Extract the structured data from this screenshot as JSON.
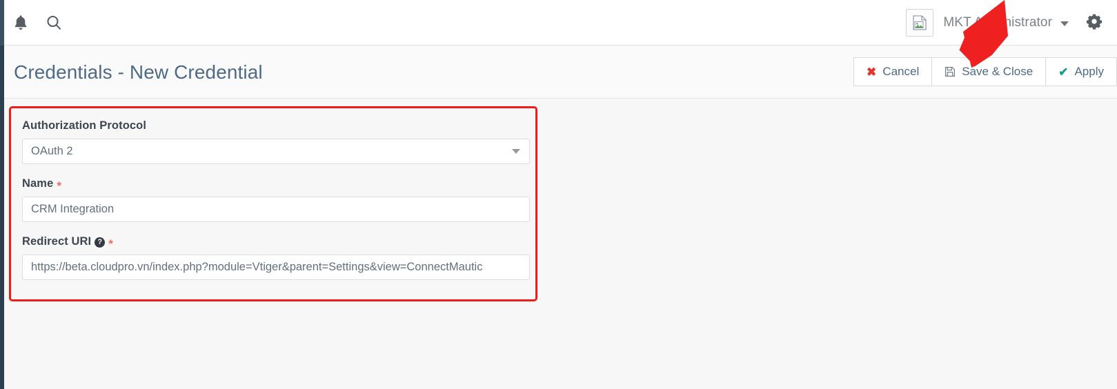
{
  "topbar": {
    "notifications_icon": "bell-icon",
    "search_icon": "search-icon",
    "avatar_alt": "broken-image-icon",
    "user_name": "MKT Administrator",
    "user_caret_icon": "chevron-down-icon",
    "settings_icon": "gear-icon"
  },
  "header": {
    "title": "Credentials - New Credential",
    "buttons": [
      {
        "label": "Cancel",
        "icon": "cross-icon",
        "glyph": "✖",
        "kind": "cancel"
      },
      {
        "label": "Save & Close",
        "icon": "floppy-disk-icon",
        "glyph": "🖫",
        "kind": "save"
      },
      {
        "label": "Apply",
        "icon": "check-icon",
        "glyph": "✔",
        "kind": "apply"
      }
    ]
  },
  "form": {
    "fields": {
      "auth_protocol": {
        "label": "Authorization Protocol",
        "value": "OAuth 2",
        "required": false,
        "control": "select",
        "caret_icon": "caret-down-icon"
      },
      "name": {
        "label": "Name",
        "value": "CRM Integration",
        "required": true,
        "required_marker": "*",
        "control": "text"
      },
      "redirect_uri": {
        "label": "Redirect URI",
        "value": "https://beta.cloudpro.vn/index.php?module=Vtiger&parent=Settings&view=ConnectMautic",
        "required": true,
        "required_marker": "*",
        "control": "text",
        "help_icon": "question-mark-icon",
        "help_glyph": "?"
      }
    }
  },
  "annotations": {
    "highlight_box_color": "#f01b1b",
    "arrow_color": "#ef2020",
    "arrow_target": "Save & Close"
  }
}
